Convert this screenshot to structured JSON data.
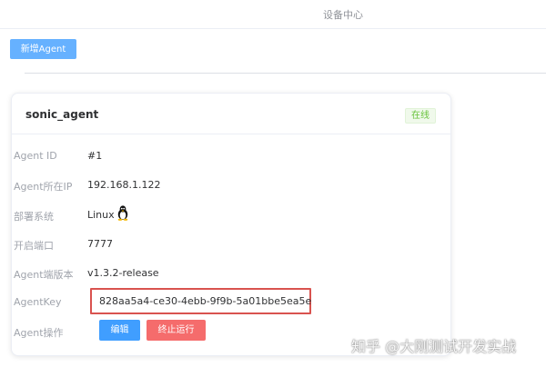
{
  "header": {
    "title": "设备中心"
  },
  "toolbar": {
    "add_label": "新增Agent"
  },
  "agent_card": {
    "name": "sonic_agent",
    "status": "在线",
    "fields": {
      "id_label": "Agent ID",
      "id_value": "#1",
      "ip_label": "Agent所在IP",
      "ip_value": "192.168.1.122",
      "os_label": "部署系统",
      "os_value": "Linux",
      "os_icon": "linux-tux-icon",
      "port_label": "开启端口",
      "port_value": "7777",
      "version_label": "Agent端版本",
      "version_value": "v1.3.2-release",
      "key_label": "AgentKey",
      "key_value": "828aa5a4-ce30-4ebb-9f9b-5a01bbe5ea5e",
      "ops_label": "Agent操作"
    },
    "actions": {
      "edit_label": "编辑",
      "stop_label": "终止运行"
    }
  },
  "watermark": "知乎 @大刚测试开发实战",
  "colors": {
    "primary": "#409eff",
    "danger": "#f56c6c",
    "success": "#67c23a",
    "highlight_border": "#d9534f"
  }
}
